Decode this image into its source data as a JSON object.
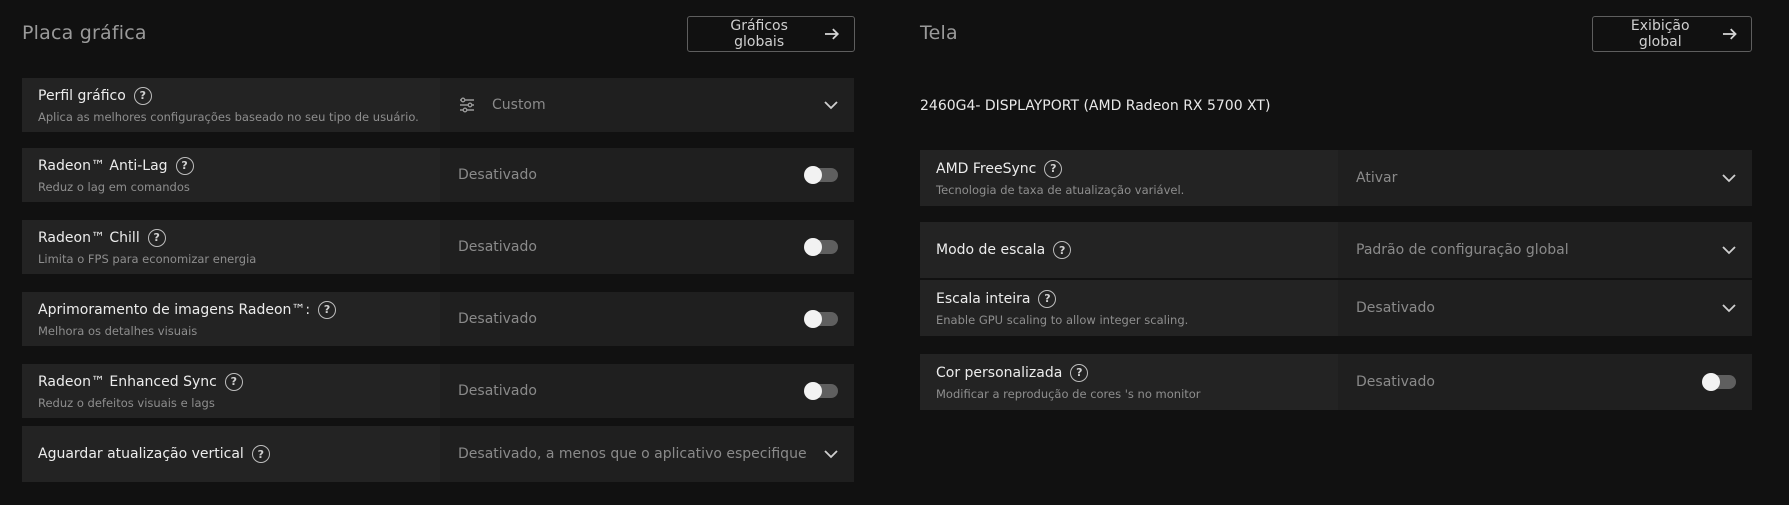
{
  "graphics": {
    "title": "Placa gráfica",
    "global_button": "Gráficos globais",
    "profile": {
      "label": "Perfil gráfico",
      "desc": "Aplica as melhores configurações baseado no seu tipo de usuário.",
      "value": "Custom"
    },
    "anti_lag": {
      "label": "Radeon™ Anti-Lag",
      "desc": "Reduz o lag em comandos",
      "value": "Desativado",
      "enabled": false
    },
    "chill": {
      "label": "Radeon™ Chill",
      "desc": "Limita o FPS para economizar energia",
      "value": "Desativado",
      "enabled": false
    },
    "image_sharpening": {
      "label": "Aprimoramento de imagens Radeon™:",
      "desc": "Melhora os detalhes visuais",
      "value": "Desativado",
      "enabled": false
    },
    "enhanced_sync": {
      "label": "Radeon™ Enhanced Sync",
      "desc": "Reduz o defeitos visuais e lags",
      "value": "Desativado",
      "enabled": false
    },
    "vsync": {
      "label": "Aguardar atualização vertical",
      "value": "Desativado, a menos que o aplicativo especifique"
    }
  },
  "display": {
    "title": "Tela",
    "global_button": "Exibição global",
    "device": "2460G4- DISPLAYPORT (AMD Radeon RX 5700 XT)",
    "freesync": {
      "label": "AMD FreeSync",
      "desc": "Tecnologia de taxa de atualização variável.",
      "value": "Ativar"
    },
    "scaling_mode": {
      "label": "Modo de escala",
      "value": "Padrão de configuração global"
    },
    "integer_scaling": {
      "label": "Escala inteira",
      "desc": "Enable GPU scaling to allow integer scaling.",
      "value": "Desativado"
    },
    "custom_color": {
      "label": "Cor personalizada",
      "desc": "Modificar a reprodução de cores 's no monitor",
      "value": "Desativado",
      "enabled": false
    }
  },
  "help_glyph": "?",
  "colors": {
    "background": "#111111",
    "row": "#232323",
    "toggle_off_track": "#5f5f5f",
    "toggle_knob": "#f2f2f2"
  }
}
